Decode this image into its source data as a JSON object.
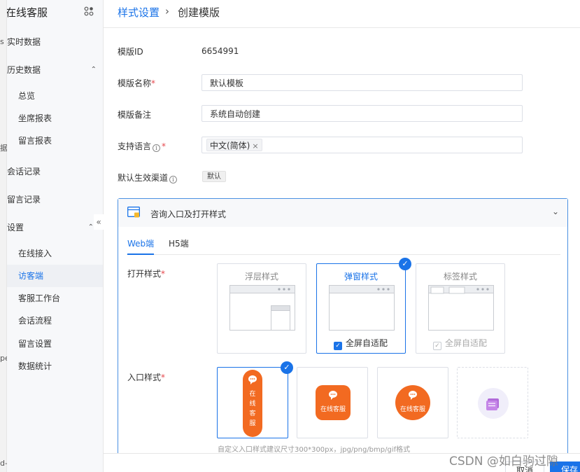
{
  "sidebar": {
    "brand": "在线客服",
    "left_fragments": [
      "s",
      "据",
      "pe",
      "d-"
    ],
    "items": [
      {
        "label": "实时数据",
        "level": "top"
      },
      {
        "label": "历史数据",
        "level": "top",
        "expanded": true
      },
      {
        "label": "总览",
        "level": "sub"
      },
      {
        "label": "坐席报表",
        "level": "sub"
      },
      {
        "label": "留言报表",
        "level": "sub"
      },
      {
        "label": "会话记录",
        "level": "top"
      },
      {
        "label": "留言记录",
        "level": "top"
      },
      {
        "label": "设置",
        "level": "top",
        "expanded": true
      },
      {
        "label": "在线接入",
        "level": "sub"
      },
      {
        "label": "访客端",
        "level": "sub",
        "active": true
      },
      {
        "label": "客服工作台",
        "level": "sub"
      },
      {
        "label": "会话流程",
        "level": "sub"
      },
      {
        "label": "留言设置",
        "level": "sub"
      },
      {
        "label": "数据统计",
        "level": "sub"
      }
    ],
    "collapse_glyph": "«"
  },
  "breadcrumb": {
    "parent": "样式设置",
    "separator": "›",
    "current": "创建模版"
  },
  "form": {
    "template_id": {
      "label": "模版ID",
      "value": "6654991"
    },
    "template_name": {
      "label": "模版名称",
      "value": "默认模板"
    },
    "template_note": {
      "label": "模版备注",
      "value": "系统自动创建"
    },
    "languages": {
      "label": "支持语言",
      "tag": "中文(简体)",
      "tag_close": "×"
    },
    "default_channel": {
      "label": "默认生效渠道",
      "badge": "默认"
    },
    "required_mark": "*",
    "info_glyph": "i"
  },
  "panel": {
    "title": "咨询入口及打开样式",
    "chevron": "⌄",
    "tabs": [
      {
        "label": "Web端",
        "active": true
      },
      {
        "label": "H5端",
        "active": false
      }
    ],
    "open_style": {
      "label": "打开样式",
      "options": [
        {
          "title": "浮层样式",
          "selected": false
        },
        {
          "title": "弹窗样式",
          "selected": true,
          "check_label": "全屏自适配",
          "checked": true
        },
        {
          "title": "标签样式",
          "selected": false,
          "check_label": "全屏自适配",
          "checked": false,
          "disabled": true
        }
      ]
    },
    "entry_style": {
      "label": "入口样式",
      "vertical_chars": [
        "在",
        "线",
        "客",
        "服"
      ],
      "button_text": "在线客服",
      "hint": "自定义入口样式建议尺寸300*300px，jpg/png/bmp/gif格式"
    }
  },
  "footer": {
    "cancel": "取消",
    "save": "保存"
  },
  "watermark": "CSDN @如白驹过隙",
  "colors": {
    "primary": "#1a73e8",
    "orange": "#f26a21",
    "purple": "#b06ad9",
    "required": "#e5484d"
  }
}
